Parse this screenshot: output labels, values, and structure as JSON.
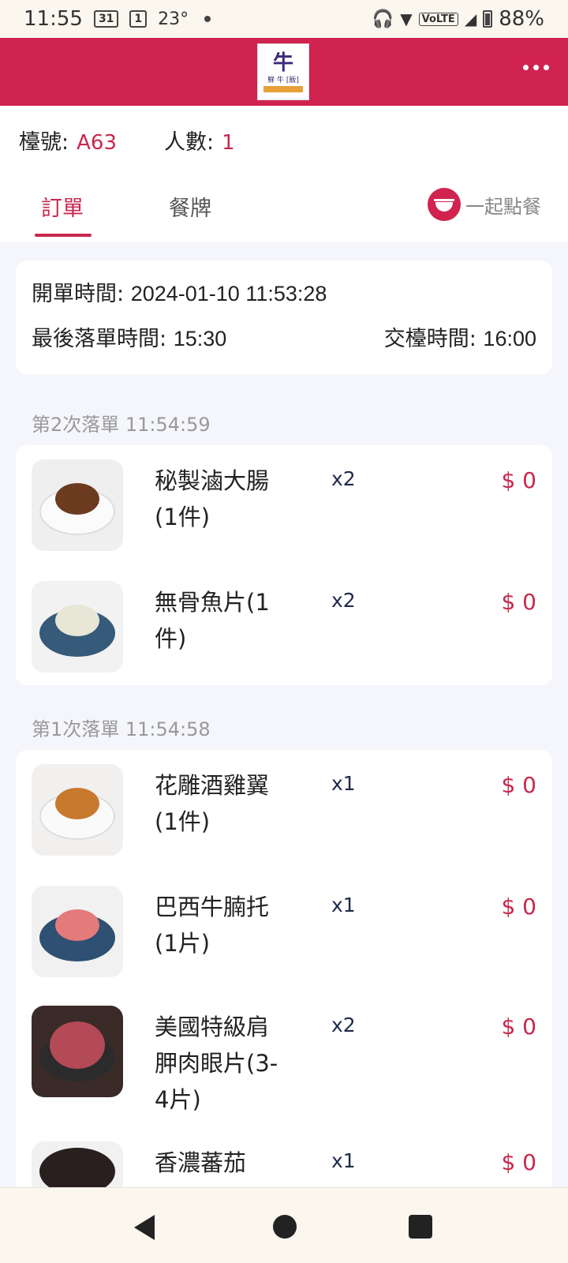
{
  "status_bar": {
    "time": "11:55",
    "calendar_badge": "31",
    "notif_badge": "1",
    "temperature": "23°",
    "volte": "VoLTE",
    "battery": "88%"
  },
  "header": {
    "logo_main": "牛",
    "logo_sub": "鮮 牛 [飯]",
    "menu_icon": "more-dots-icon"
  },
  "table": {
    "table_label": "檯號:",
    "table_no": "A63",
    "people_label": "人數:",
    "people_count": "1"
  },
  "tabs": {
    "order": "訂單",
    "menu": "餐牌",
    "together": "一起點餐"
  },
  "times": {
    "open_label": "開單時間:",
    "open_value": "2024-01-10 11:53:28",
    "last_label": "最後落單時間:",
    "last_value": "15:30",
    "return_label": "交檯時間:",
    "return_value": "16:00"
  },
  "batches": [
    {
      "label": "第2次落單 11:54:59",
      "items": [
        {
          "name": "秘製滷大腸(1件)",
          "qty": "x2",
          "price": "$ 0"
        },
        {
          "name": "無骨魚片(1件)",
          "qty": "x2",
          "price": "$ 0"
        }
      ]
    },
    {
      "label": "第1次落單 11:54:58",
      "items": [
        {
          "name": "花雕酒雞翼(1件)",
          "qty": "x1",
          "price": "$ 0"
        },
        {
          "name": "巴西牛腩托(1片)",
          "qty": "x1",
          "price": "$ 0"
        },
        {
          "name": "美國特級肩胛肉眼片(3-4片)",
          "qty": "x2",
          "price": "$ 0"
        },
        {
          "name": "香濃蕃茄",
          "qty": "x1",
          "price": "$ 0"
        }
      ]
    }
  ],
  "colors": {
    "brand": "#d0234f",
    "accent_text": "#c8284d"
  }
}
